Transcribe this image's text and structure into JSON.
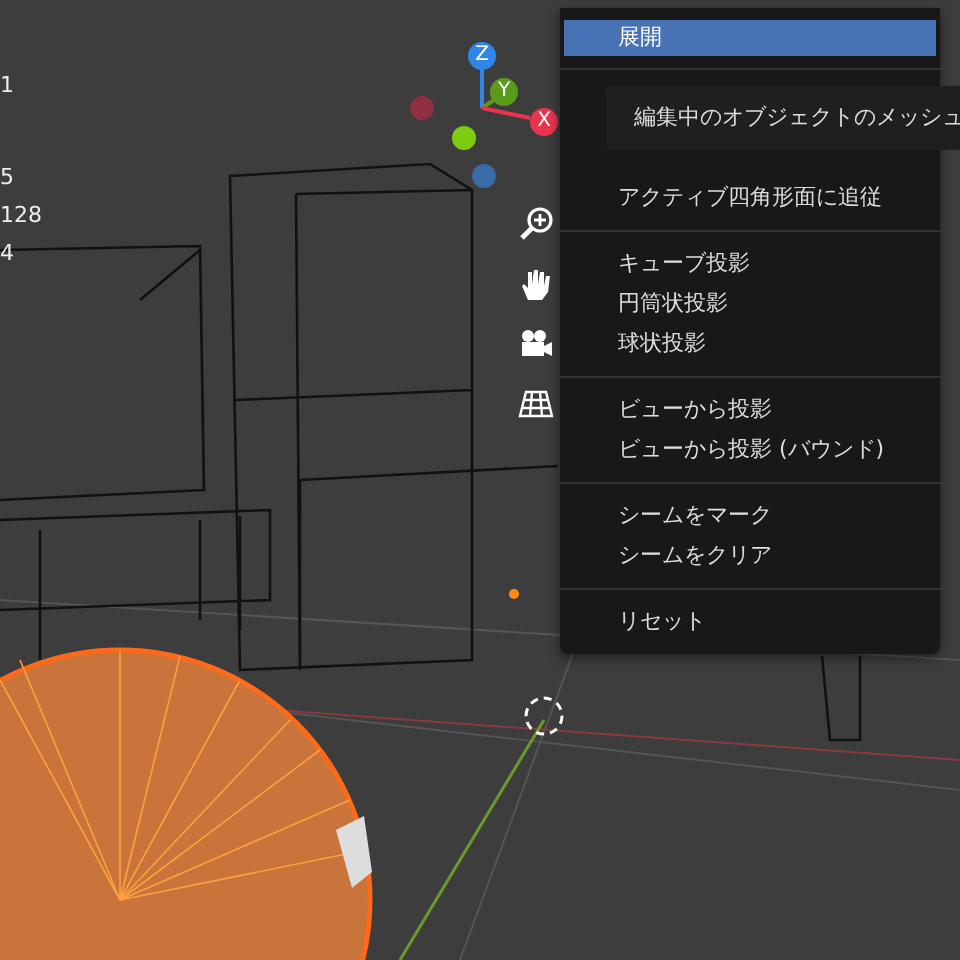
{
  "viewport": {
    "stats": [
      "1",
      "5",
      "128",
      "4"
    ],
    "gizmo": {
      "axes": [
        {
          "label": "Z",
          "color": "#2f86e8"
        },
        {
          "label": "Y",
          "color": "#5a9a1a"
        },
        {
          "label": "X",
          "color": "#e8344e"
        }
      ]
    }
  },
  "menu": {
    "items": [
      {
        "kind": "item",
        "label": "展開",
        "selected": true
      },
      {
        "kind": "separator"
      },
      {
        "kind": "gap"
      },
      {
        "kind": "item",
        "label": "アクティブ四角形面に追従",
        "selected": false
      },
      {
        "kind": "separator"
      },
      {
        "kind": "item",
        "label": "キューブ投影",
        "selected": false
      },
      {
        "kind": "item",
        "label": "円筒状投影",
        "selected": false
      },
      {
        "kind": "item",
        "label": "球状投影",
        "selected": false
      },
      {
        "kind": "separator"
      },
      {
        "kind": "item",
        "label": "ビューから投影",
        "selected": false
      },
      {
        "kind": "item",
        "label": "ビューから投影 (バウンド)",
        "selected": false
      },
      {
        "kind": "separator"
      },
      {
        "kind": "item",
        "label": "シームをマーク",
        "selected": false
      },
      {
        "kind": "item",
        "label": "シームをクリア",
        "selected": false
      },
      {
        "kind": "separator"
      },
      {
        "kind": "item",
        "label": "リセット",
        "selected": false
      }
    ]
  },
  "tooltip": {
    "text": "編集中のオブジェクトのメッシュ"
  }
}
